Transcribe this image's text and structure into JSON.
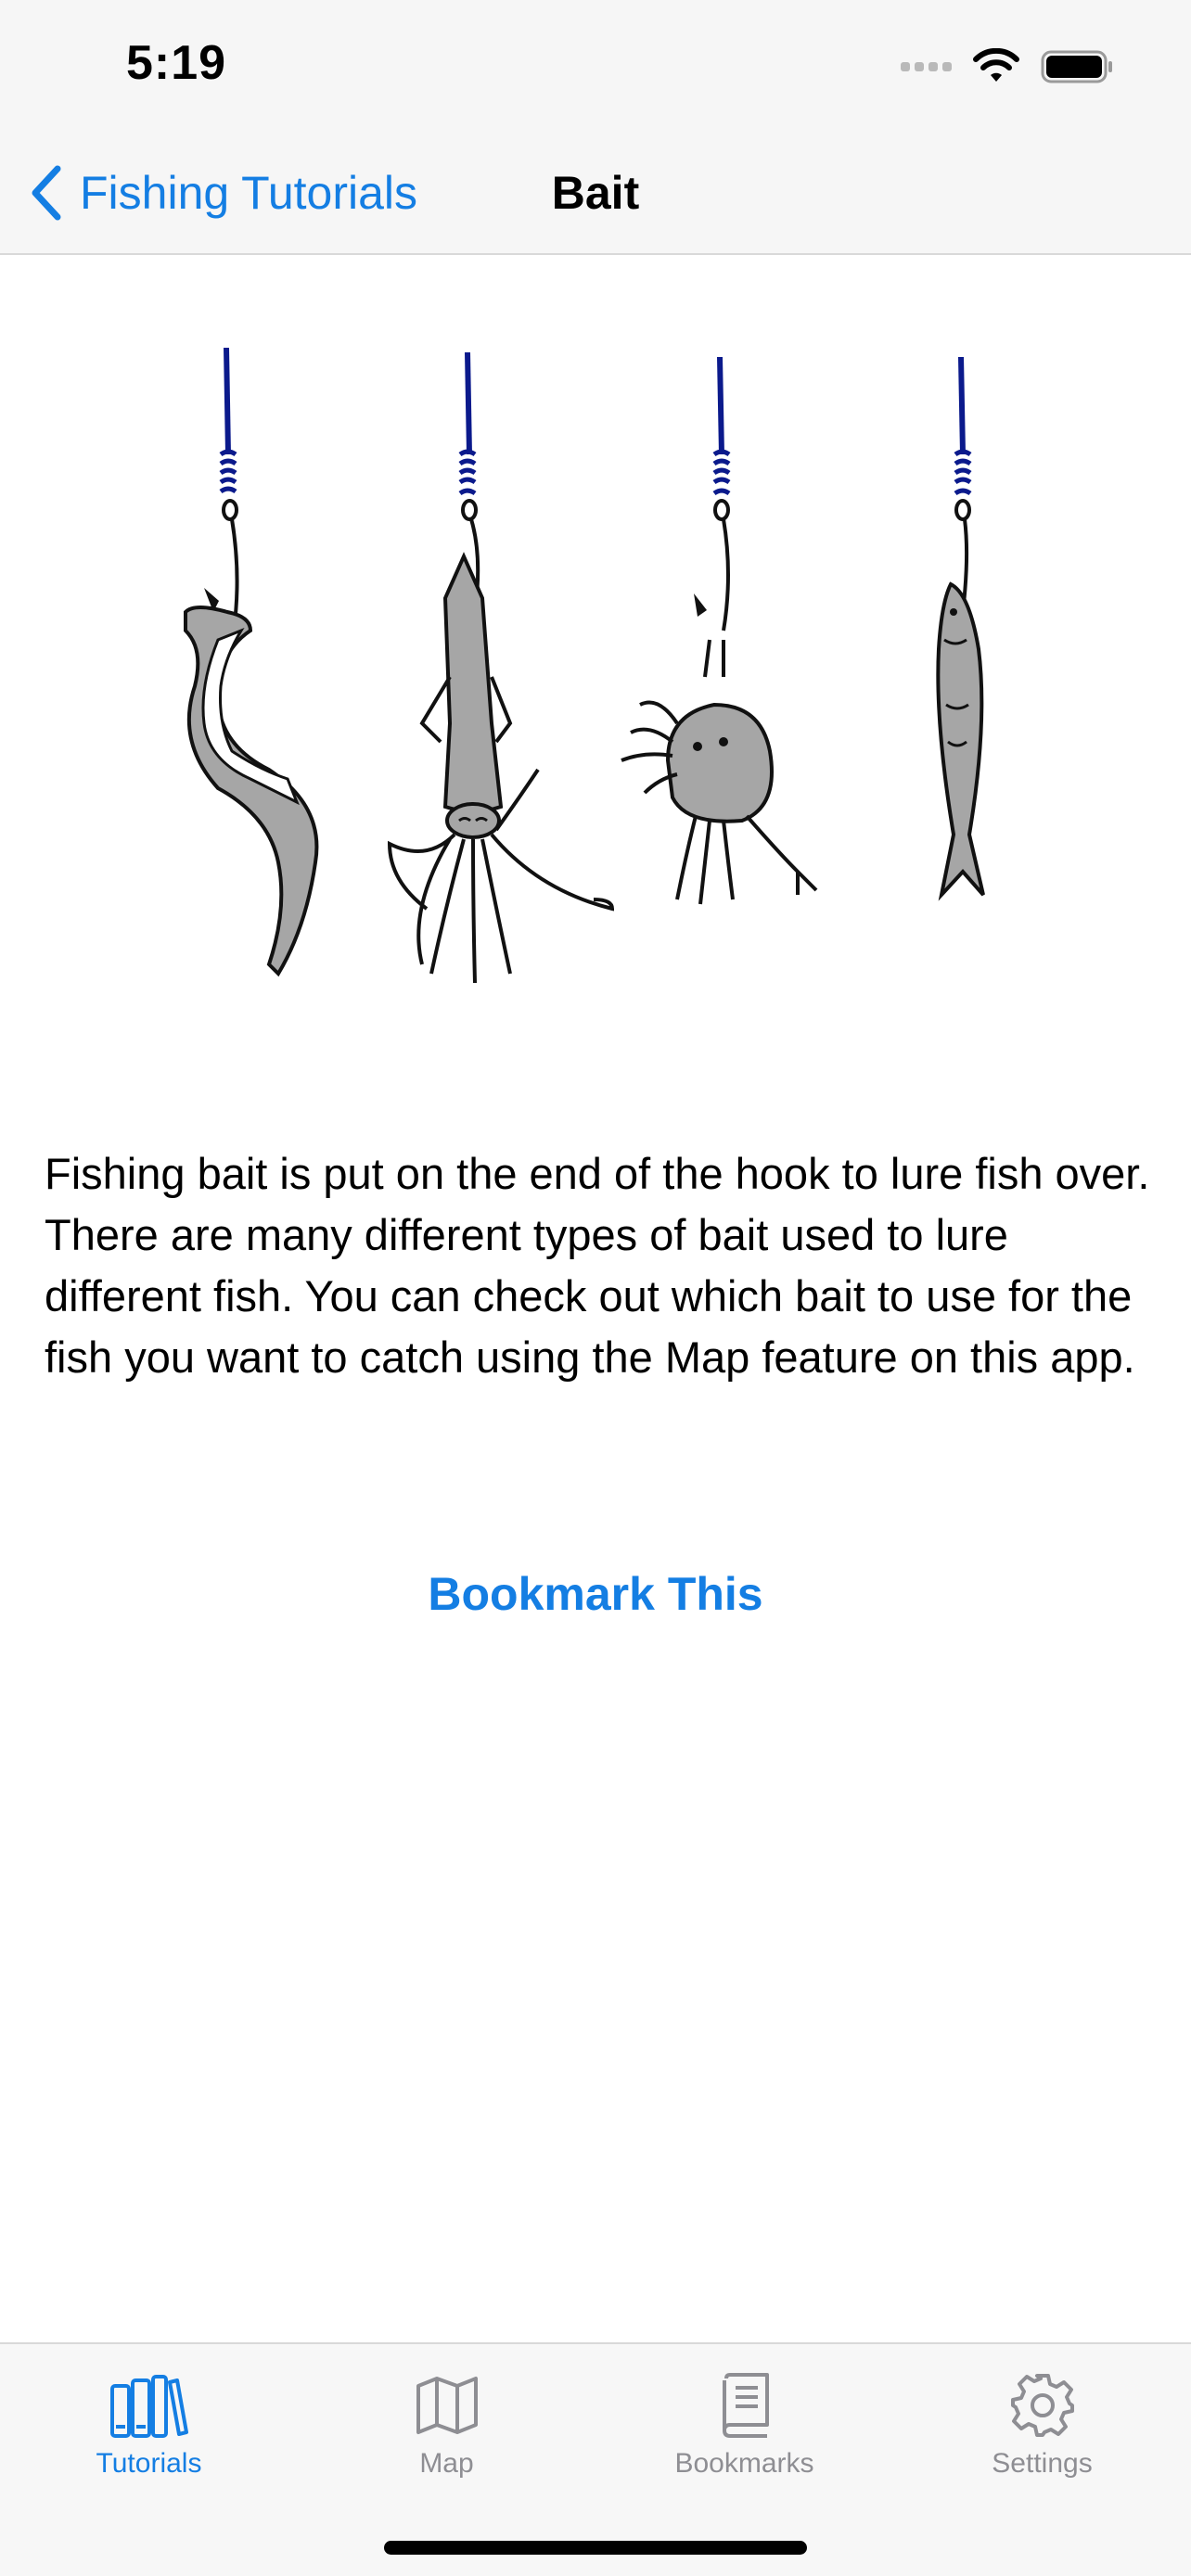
{
  "status_bar": {
    "time": "5:19"
  },
  "nav": {
    "back_label": "Fishing Tutorials",
    "title": "Bait"
  },
  "content": {
    "paragraphs": [
      "Fishing bait is put on the end of the hook to lure fish over.",
      "There are many different types of bait used to lure different fish. You can check out which bait to use for the fish you want to catch using the Map feature on this app."
    ],
    "bookmark_label": "Bookmark This",
    "illustration_baits": [
      "worm",
      "squid",
      "crab",
      "fish"
    ]
  },
  "tab_bar": {
    "tabs": [
      {
        "label": "Tutorials",
        "icon": "books-icon",
        "active": true
      },
      {
        "label": "Map",
        "icon": "map-icon",
        "active": false
      },
      {
        "label": "Bookmarks",
        "icon": "book-icon",
        "active": false
      },
      {
        "label": "Settings",
        "icon": "gear-icon",
        "active": false
      }
    ]
  },
  "colors": {
    "accent": "#147ee3",
    "inactive": "#8e8e93",
    "line": "#0b1a8c",
    "bait_fill": "#a6a6a6"
  }
}
